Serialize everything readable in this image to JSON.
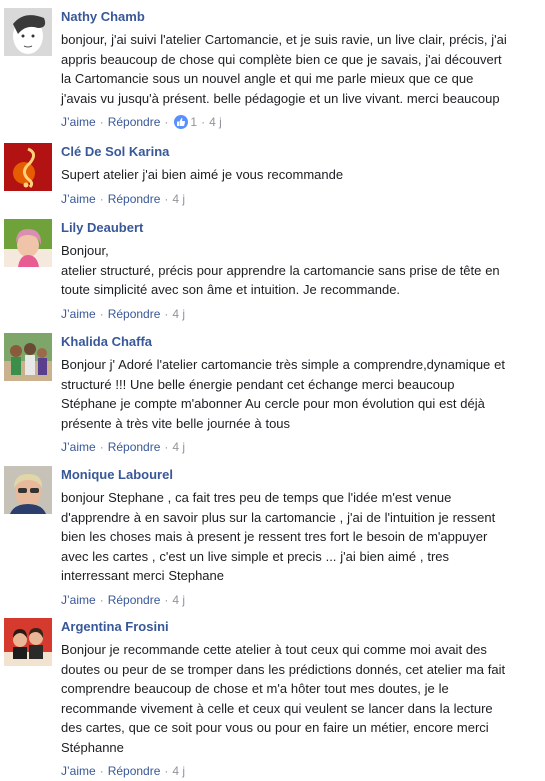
{
  "comments": [
    {
      "author": "Nathy Chamb",
      "lines": [
        "bonjour, j'ai suivi l'atelier Cartomancie, et je suis ravie, un live clair, précis, j'ai",
        "appris beaucoup de chose qui complète bien ce que je savais, j'ai découvert",
        "la Cartomancie sous un nouvel angle et qui me parle mieux que ce que",
        "j'avais vu jusqu'à présent. belle pédagogie et un live vivant. merci beaucoup"
      ],
      "like_label": "J’aime",
      "reply_label": "Répondre",
      "reaction_count": "1",
      "time": "4 j"
    },
    {
      "author": "Clé De Sol Karina",
      "lines": [
        "Supert atelier j'ai bien aimé je vous recommande"
      ],
      "like_label": "J’aime",
      "reply_label": "Répondre",
      "time": "4 j"
    },
    {
      "author": "Lily Deaubert",
      "lines": [
        "Bonjour,",
        "atelier structuré, précis pour apprendre la cartomancie sans prise de tête en",
        "toute simplicité avec son âme et intuition. Je recommande."
      ],
      "like_label": "J’aime",
      "reply_label": "Répondre",
      "time": "4 j"
    },
    {
      "author": "Khalida Chaffa",
      "lines": [
        "Bonjour j' Adoré l'atelier cartomancie très simple a comprendre,dynamique et",
        "structuré !!! Une belle énergie pendant cet échange merci beaucoup",
        "Stéphane je compte m'abonner Au cercle pour mon évolution qui est déjà",
        "présente à très vite belle journée à tous"
      ],
      "like_label": "J’aime",
      "reply_label": "Répondre",
      "time": "4 j"
    },
    {
      "author": "Monique Labourel",
      "lines": [
        "bonjour Stephane , ca fait tres peu de temps que l'idée m'est venue",
        "d'apprendre à en savoir plus sur la cartomancie , j'ai de l'intuition je ressent",
        "bien les choses mais à present je ressent tres fort le besoin de m'appuyer",
        "avec les cartes , c'est un live simple et precis ... j'ai bien aimé , tres",
        "interressant merci Stephane"
      ],
      "like_label": "J’aime",
      "reply_label": "Répondre",
      "time": "4 j"
    },
    {
      "author": "Argentina Frosini",
      "lines": [
        "Bonjour je recommande cette atelier à tout ceux qui comme moi avait des",
        "doutes ou peur de se tromper dans les prédictions donnés, cet atelier ma fait",
        "comprendre beaucoup de chose et m'a hôter tout mes doutes, je le",
        "recommande vivement à celle et ceux qui veulent se lancer dans la lecture",
        "des cartes, que ce soit pour vous ou pour en faire un métier, encore merci",
        "Stéphanne"
      ],
      "like_label": "J’aime",
      "reply_label": "Répondre",
      "time": "4 j"
    }
  ],
  "separator": "·",
  "colors": {
    "name_link": "#385898",
    "meta_gray": "#90949c",
    "body_text": "#1c1e21",
    "like_badge": "#5890ff"
  }
}
